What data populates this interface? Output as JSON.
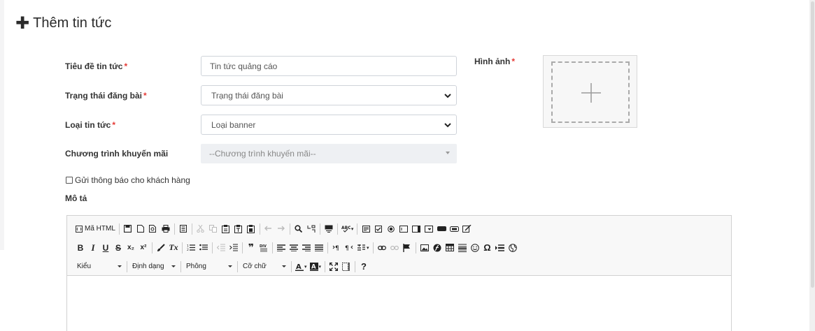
{
  "page": {
    "title": "Thêm tin tức",
    "plus_icon": "plus-icon"
  },
  "form": {
    "title_label": "Tiêu đề tin tức",
    "title_value": "Tin tức quảng cáo",
    "status_label": "Trạng thái đăng bài",
    "status_value": "Trạng thái đăng bài",
    "type_label": "Loại tin tức",
    "type_value": "Loại banner",
    "promo_label": "Chương trình khuyến mãi",
    "promo_value": "--Chương trình khuyến mãi--",
    "notify_label": "Gửi thông báo cho khách hàng",
    "notify_checked": false,
    "desc_label": "Mô tả",
    "image_label": "Hình ảnh",
    "required_mark": "*"
  },
  "editor": {
    "source_label": "Mã HTML",
    "combos": {
      "style": "Kiểu",
      "format": "Định dạng",
      "font": "Phông",
      "size": "Cỡ chữ"
    },
    "row2_text": {
      "bold": "B",
      "italic": "I",
      "underline": "U",
      "strike": "S",
      "subscript": "x₂",
      "superscript": "x²",
      "remove_format": "Tx",
      "quote": "❞",
      "omega": "Ω"
    },
    "help": "?"
  },
  "colors": {
    "required": "#e53935",
    "border": "#cfd4da",
    "disabled_bg": "#eef0f3",
    "toolbar_bg": "#f8f8f8"
  }
}
